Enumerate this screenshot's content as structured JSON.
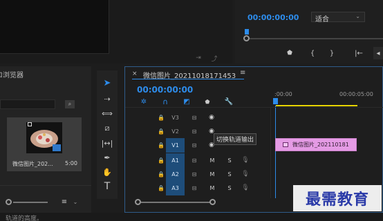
{
  "program_monitor": {
    "timecode": "00:00:00:00",
    "fit_label": "适合"
  },
  "project_panel": {
    "title_fragment": "ロ浏览器",
    "item_name": "微信图片_202...",
    "item_duration": "5:00"
  },
  "timeline": {
    "sequence_title": "微信图片_20211018171453",
    "timecode": "00:00:00:00",
    "ruler_start": ":00:00",
    "ruler_end": "00:00:05:00",
    "tracks": [
      {
        "label": "V3",
        "col2": "",
        "col3": ""
      },
      {
        "label": "V2",
        "col2": "",
        "col3": ""
      },
      {
        "label": "V1",
        "col2": "",
        "col3": ""
      },
      {
        "label": "A1",
        "col2": "M",
        "col3": "S"
      },
      {
        "label": "A2",
        "col2": "M",
        "col3": "S"
      },
      {
        "label": "A3",
        "col2": "M",
        "col3": "S"
      }
    ],
    "clip_label": "微信图片_202110181",
    "tooltip": "切换轨道输出"
  },
  "status_bar": {
    "text": "轨道的高度。"
  },
  "watermark": "最需教育",
  "colors": {
    "accent_blue": "#2d8ceb",
    "clip_pink": "#e59be5",
    "track_on": "#1e4d7a",
    "work_area_yellow": "#e6d400"
  }
}
